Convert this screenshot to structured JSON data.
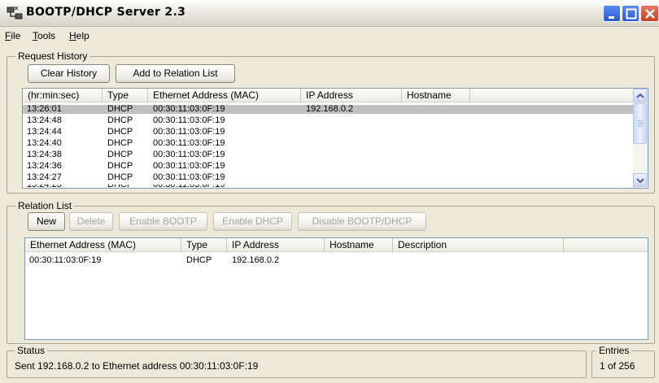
{
  "window": {
    "title": "BOOTP/DHCP Server 2.3"
  },
  "menu": {
    "items": [
      {
        "first": "F",
        "rest": "ile"
      },
      {
        "first": "T",
        "rest": "ools"
      },
      {
        "first": "H",
        "rest": "elp"
      }
    ]
  },
  "request_history": {
    "label": "Request History",
    "clear_button": "Clear History",
    "add_button": "Add to Relation List",
    "columns": [
      "(hr:min:sec)",
      "Type",
      "Ethernet Address (MAC)",
      "IP Address",
      "Hostname"
    ],
    "rows": [
      {
        "time": "13:26:01",
        "type": "DHCP",
        "mac": "00:30:11:03:0F:19",
        "ip": "192.168.0.2",
        "host": ""
      },
      {
        "time": "13:24:48",
        "type": "DHCP",
        "mac": "00:30:11:03:0F:19",
        "ip": "",
        "host": ""
      },
      {
        "time": "13:24:44",
        "type": "DHCP",
        "mac": "00:30:11:03:0F:19",
        "ip": "",
        "host": ""
      },
      {
        "time": "13:24:40",
        "type": "DHCP",
        "mac": "00:30:11:03:0F:19",
        "ip": "",
        "host": ""
      },
      {
        "time": "13:24:38",
        "type": "DHCP",
        "mac": "00:30:11:03:0F:19",
        "ip": "",
        "host": ""
      },
      {
        "time": "13:24:36",
        "type": "DHCP",
        "mac": "00:30:11:03:0F:19",
        "ip": "",
        "host": ""
      },
      {
        "time": "13:24:27",
        "type": "DHCP",
        "mac": "00:30:11:03:0F:19",
        "ip": "",
        "host": ""
      }
    ]
  },
  "relation_list": {
    "label": "Relation List",
    "new_button": "New",
    "delete_button": "Delete",
    "enable_bootp_button": "Enable BOOTP",
    "enable_dhcp_button": "Enable DHCP",
    "disable_button": "Disable BOOTP/DHCP",
    "columns": [
      "Ethernet Address (MAC)",
      "Type",
      "IP Address",
      "Hostname",
      "Description"
    ],
    "rows": [
      {
        "mac": "00:30:11:03:0F:19",
        "type": "DHCP",
        "ip": "192.168.0.2",
        "host": "",
        "desc": ""
      }
    ]
  },
  "status": {
    "label": "Status",
    "text": "Sent 192.168.0.2 to Ethernet address 00:30:11:03:0F:19"
  },
  "entries": {
    "label": "Entries",
    "text": "1 of 256"
  },
  "colors": {
    "selected_row": "#c0c0c0",
    "background": "#ece9d8",
    "close_button": "#d4502c"
  }
}
